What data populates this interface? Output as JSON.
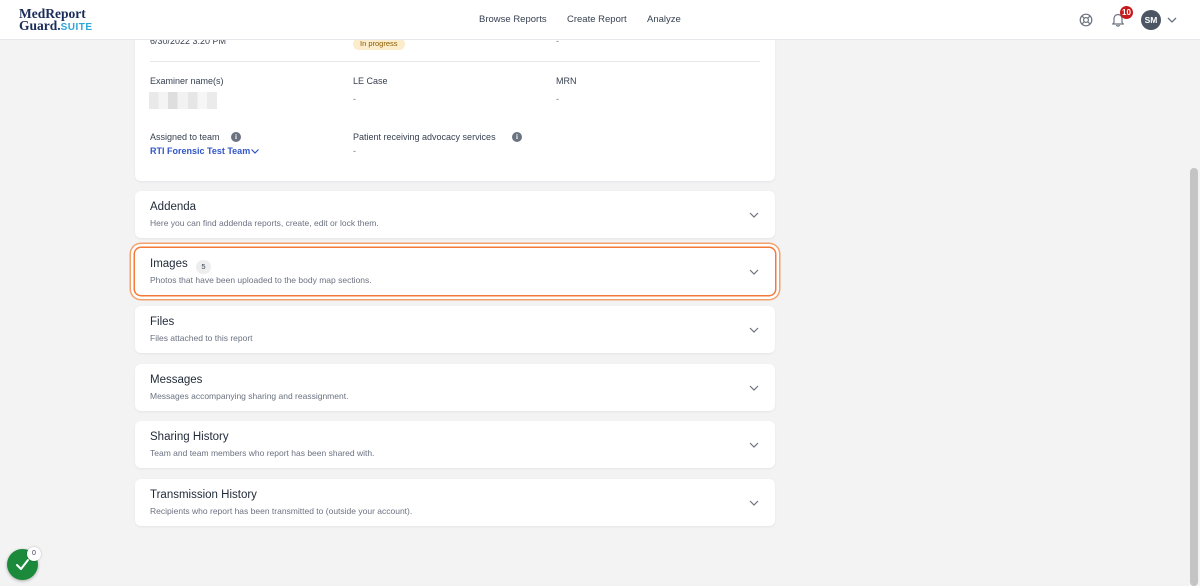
{
  "brand": {
    "line1": "MedReport",
    "line2": "Guard.",
    "suffix": "SUITE"
  },
  "nav": {
    "items": [
      "Browse Reports",
      "Create Report",
      "Analyze"
    ]
  },
  "header": {
    "notifications_count": "10",
    "user_initials": "SM"
  },
  "report_info": {
    "partial_date": "6/30/2022 3:20 PM",
    "partial_status": "In progress",
    "partial_dash": "-",
    "examiner_label": "Examiner name(s)",
    "le_case_label": "LE Case",
    "le_case_value": "-",
    "mrn_label": "MRN",
    "mrn_value": "-",
    "assigned_team_label": "Assigned to team",
    "assigned_team_value": "RTI Forensic Test Team",
    "advocacy_label": "Patient receiving advocacy services",
    "advocacy_value": "-"
  },
  "sections": [
    {
      "title": "Addenda",
      "subtitle": "Here you can find addenda reports, create, edit or lock them."
    },
    {
      "title": "Images",
      "count": "5",
      "subtitle": "Photos that have been uploaded to the body map sections."
    },
    {
      "title": "Files",
      "subtitle": "Files attached to this report"
    },
    {
      "title": "Messages",
      "subtitle": "Messages accompanying sharing and reassignment."
    },
    {
      "title": "Sharing History",
      "subtitle": "Team and team members who report has been shared with."
    },
    {
      "title": "Transmission History",
      "subtitle": "Recipients who report has been transmitted to (outside your account)."
    }
  ],
  "status_widget": {
    "count": "0"
  },
  "icons": {
    "help": "lifebuoy-icon",
    "notifications": "bell-icon",
    "expand": "chevron-down-icon",
    "info": "info-icon",
    "status": "check-icon"
  },
  "colors": {
    "accent_link": "#2f55c9",
    "focus_ring": "#f47a3a",
    "badge_red": "#c71a1a",
    "status_green": "#1c8a3b",
    "pill_bg": "#fbeccb"
  }
}
